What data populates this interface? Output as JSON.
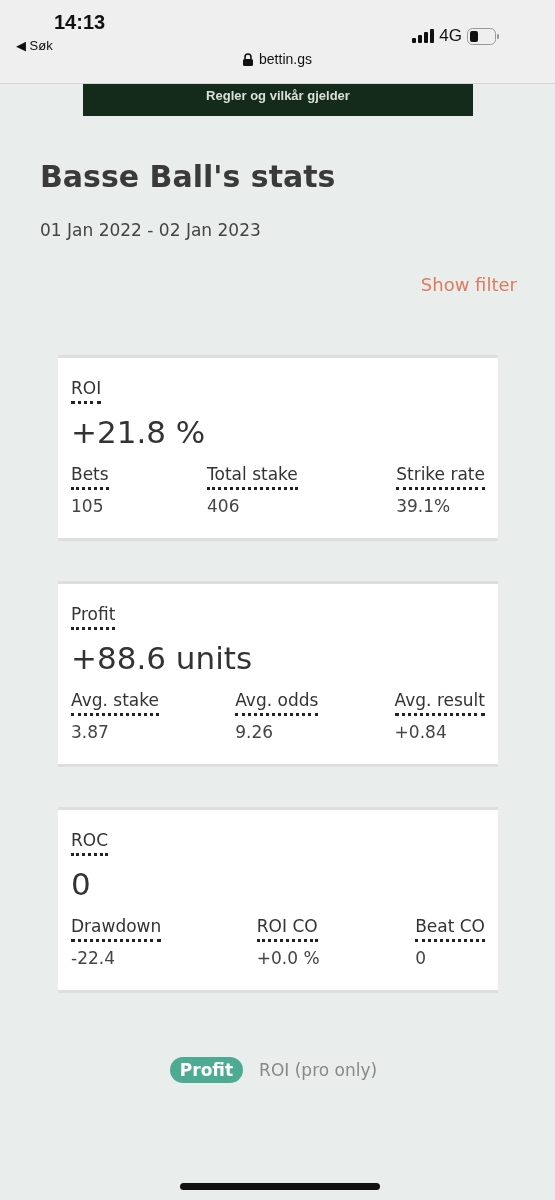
{
  "status_bar": {
    "time": "14:13",
    "back": "◀ Søk",
    "network": "4G"
  },
  "address_bar": {
    "url": "bettin.gs"
  },
  "banner": {
    "text": "Regler og vilkår gjelder"
  },
  "title": "Basse Ball's stats",
  "date_range": "01 Jan 2022 - 02 Jan 2023",
  "filter_link": "Show filter",
  "cards": [
    {
      "label": "ROI",
      "value": "+21.8 %",
      "stats": [
        {
          "label": "Bets",
          "value": "105"
        },
        {
          "label": "Total stake",
          "value": "406"
        },
        {
          "label": "Strike rate",
          "value": "39.1%"
        }
      ]
    },
    {
      "label": "Profit",
      "value": "+88.6 units",
      "stats": [
        {
          "label": "Avg. stake",
          "value": "3.87"
        },
        {
          "label": "Avg. odds",
          "value": "9.26"
        },
        {
          "label": "Avg. result",
          "value": "+0.84"
        }
      ]
    },
    {
      "label": "ROC",
      "value": "0",
      "stats": [
        {
          "label": "Drawdown",
          "value": "-22.4"
        },
        {
          "label": "ROI CO",
          "value": "+0.0 %"
        },
        {
          "label": "Beat CO",
          "value": "0"
        }
      ]
    }
  ],
  "tabs": [
    {
      "label": "Profit",
      "selected": true
    },
    {
      "label": "ROI (pro only)",
      "selected": false
    }
  ]
}
